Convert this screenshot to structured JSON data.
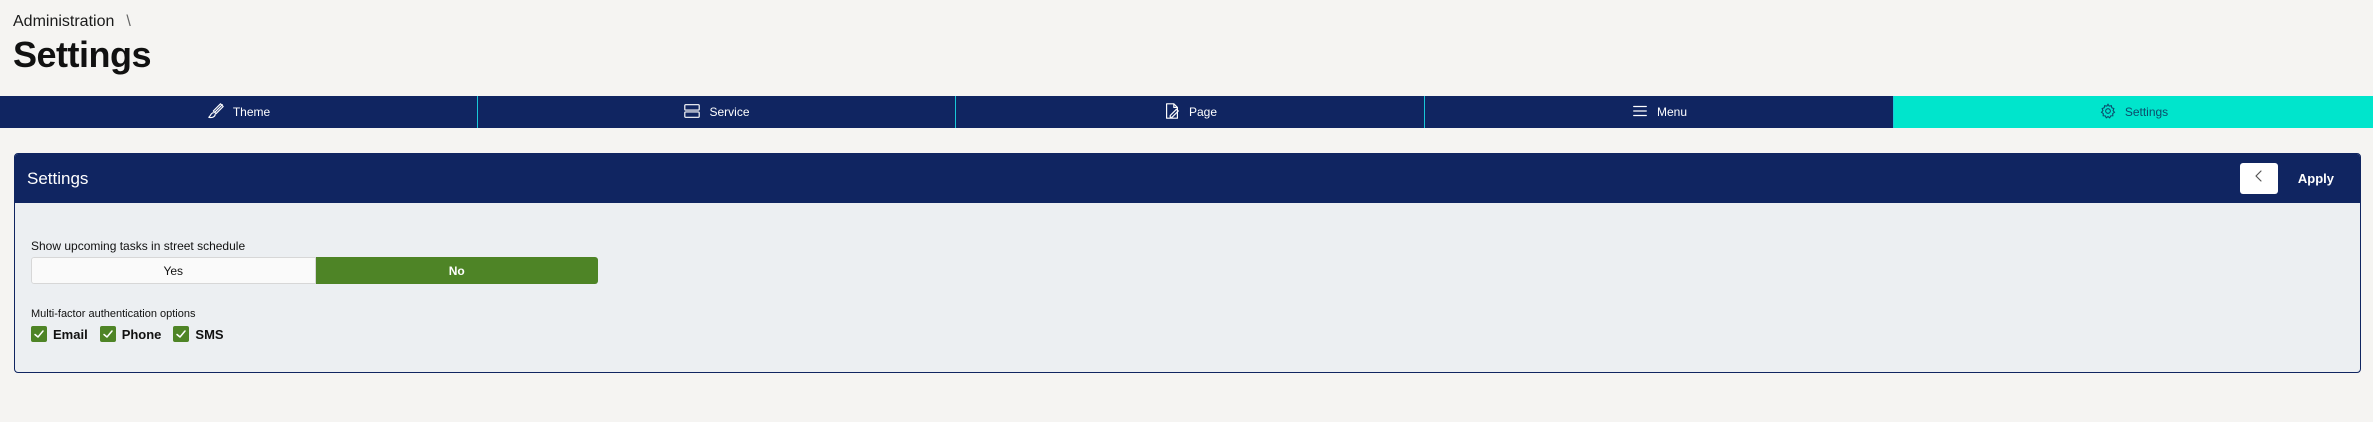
{
  "breadcrumb": {
    "parent": "Administration",
    "separator": "\\"
  },
  "page": {
    "title": "Settings"
  },
  "tabs": [
    {
      "label": "Theme",
      "icon": "brush-icon"
    },
    {
      "label": "Service",
      "icon": "server-icon"
    },
    {
      "label": "Page",
      "icon": "page-edit-icon"
    },
    {
      "label": "Menu",
      "icon": "menu-icon"
    },
    {
      "label": "Settings",
      "icon": "gear-icon",
      "active": true
    }
  ],
  "panel": {
    "title": "Settings",
    "apply_label": "Apply",
    "back_icon": "chevron-left-icon"
  },
  "street_schedule": {
    "label": "Show upcoming tasks in street schedule",
    "options": [
      "Yes",
      "No"
    ],
    "selected": "No"
  },
  "mfa": {
    "label": "Multi-factor authentication options",
    "options": [
      {
        "label": "Email",
        "checked": true
      },
      {
        "label": "Phone",
        "checked": true
      },
      {
        "label": "SMS",
        "checked": true
      }
    ]
  },
  "colors": {
    "navy": "#102561",
    "accent": "#00e5cc",
    "green": "#4e8426",
    "background": "#f5f4f2"
  }
}
